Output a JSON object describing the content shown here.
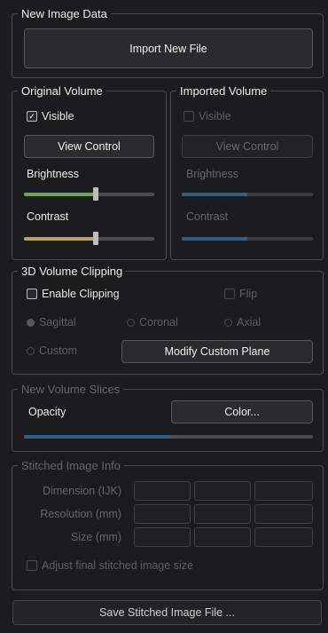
{
  "new_image_data": {
    "legend": "New Image Data",
    "import_button": "Import New File"
  },
  "original_volume": {
    "legend": "Original Volume",
    "visible_label": "Visible",
    "visible_checked": true,
    "view_control": "View Control",
    "brightness_label": "Brightness",
    "brightness_value": 0.55,
    "contrast_label": "Contrast",
    "contrast_value": 0.55
  },
  "imported_volume": {
    "legend": "Imported Volume",
    "visible_label": "Visible",
    "view_control": "View Control",
    "brightness_label": "Brightness",
    "contrast_label": "Contrast"
  },
  "clipping": {
    "legend": "3D Volume Clipping",
    "enable_label": "Enable Clipping",
    "flip_label": "Flip",
    "sagittal": "Sagittal",
    "coronal": "Coronal",
    "axial": "Axial",
    "custom": "Custom",
    "modify_button": "Modify Custom Plane"
  },
  "slices": {
    "legend": "New Volume Slices",
    "opacity_label": "Opacity",
    "color_button": "Color..."
  },
  "stitched": {
    "legend": "Stitched Image Info",
    "dimension_label": "Dimension (IJK)",
    "resolution_label": "Resolution (mm)",
    "size_label": "Size (mm)",
    "adjust_label": "Adjust final stitched image size"
  },
  "save_button": "Save Stitched Image File ...",
  "colors": {
    "accent_green": "#6aa84f",
    "accent_tan": "#b5a16a",
    "accent_blue": "#2f5f86"
  }
}
